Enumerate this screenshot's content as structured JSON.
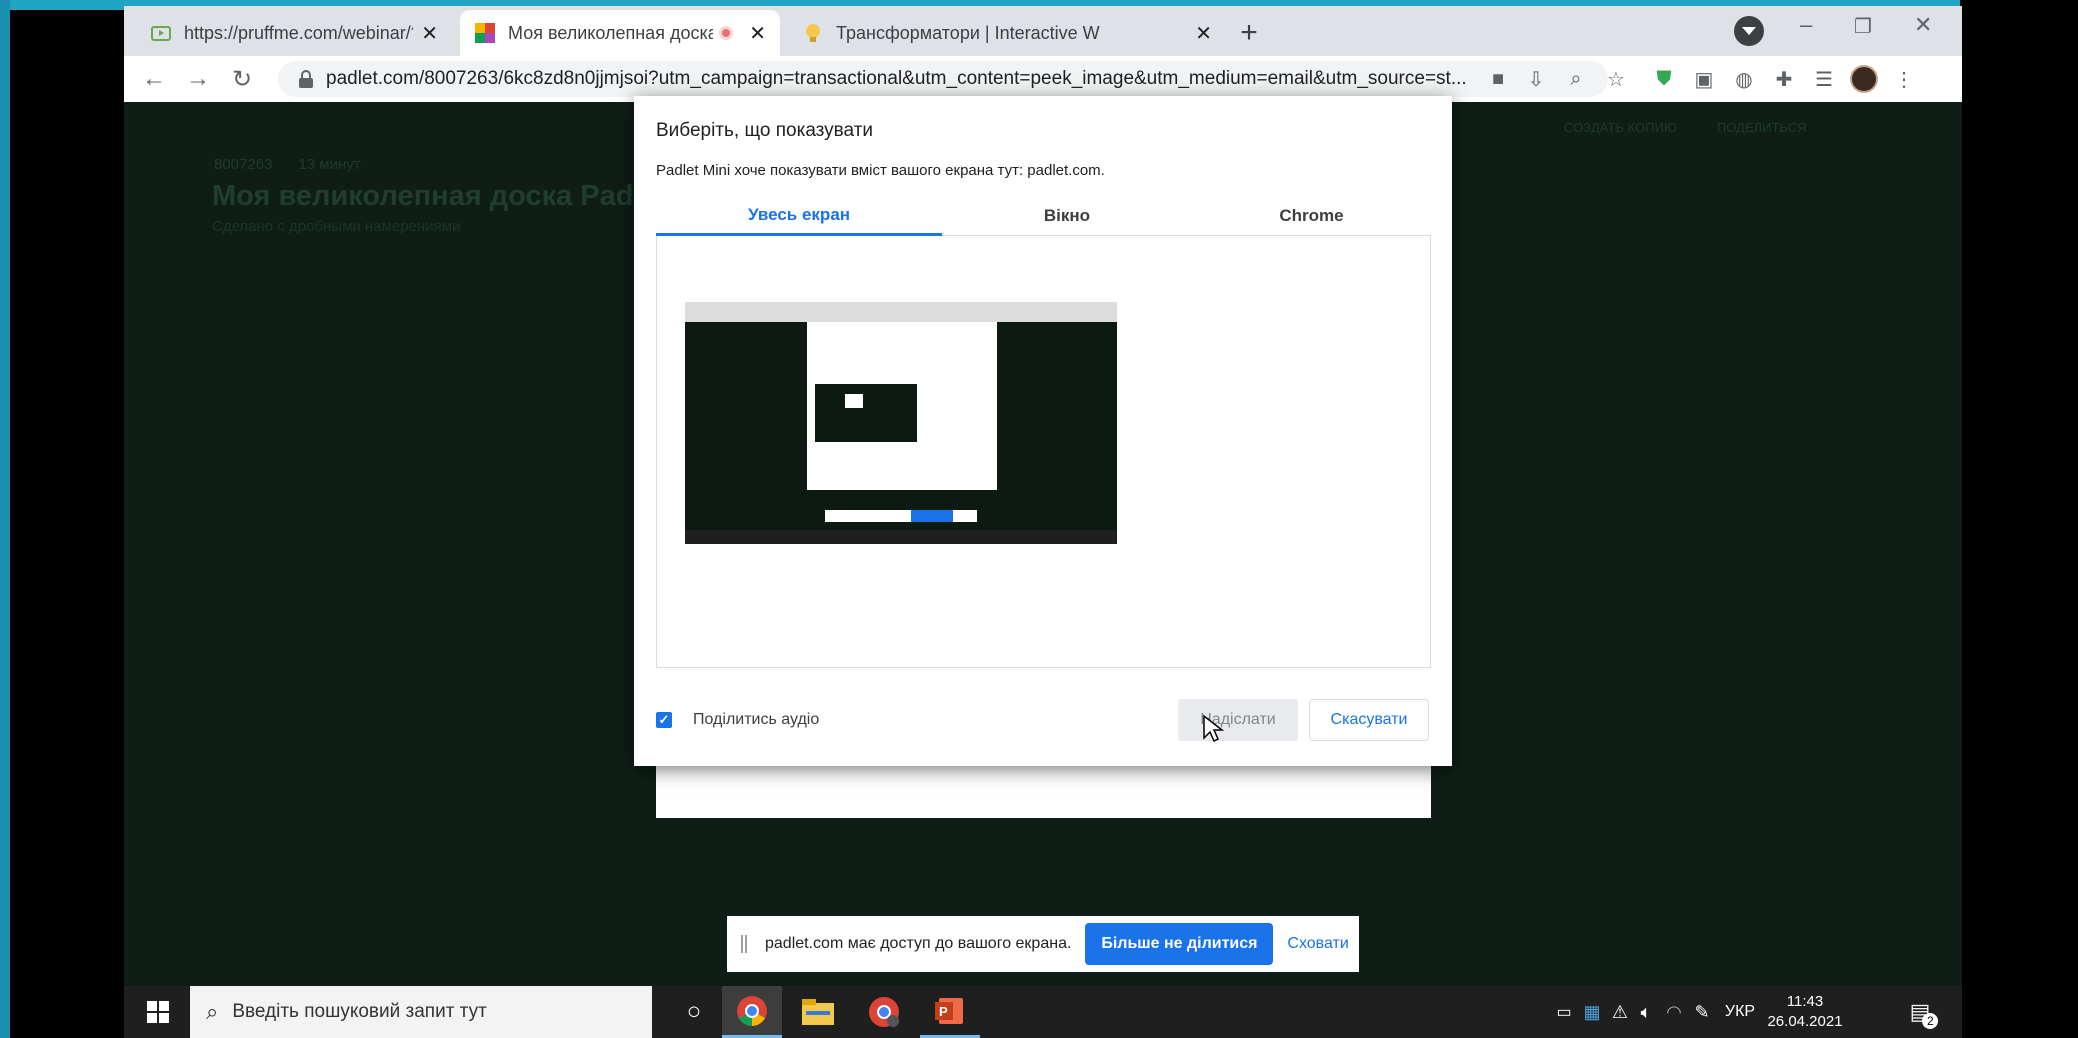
{
  "browser": {
    "tabs": [
      {
        "title": "https://pruffme.com/webinar/?id",
        "close": "✕"
      },
      {
        "title": "Моя великолепная доска Pa",
        "close": "✕"
      },
      {
        "title": "Трансформатори | Interactive W",
        "close": "✕"
      }
    ],
    "new_tab": "+",
    "url": "padlet.com/8007263/6kc8zd8n0jjmjsoi?utm_campaign=transactional&utm_content=peek_image&utm_medium=email&utm_source=st...",
    "window_controls": {
      "minimize": "–",
      "restore": "❐",
      "close": "✕"
    }
  },
  "page_bg": {
    "breadcrumb_user": "8007263",
    "breadcrumb_time": "13 минут",
    "title": "Моя великолепная доска Padlet",
    "subtitle": "Сделано с дробными намерениями",
    "header_action1": "СОЗДАТЬ КОПИЮ",
    "header_action2": "ПОДЕЛИТЬСЯ"
  },
  "dialog": {
    "title": "Виберіть, що показувати",
    "description": "Padlet Mini хоче показувати вміст вашого екрана тут: padlet.com.",
    "tabs": [
      "Увесь екран",
      "Вікно",
      "Chrome"
    ],
    "share_audio": "Поділитись аудіо",
    "share_audio_checked": true,
    "send_button": "Надіслати",
    "cancel_button": "Скасувати"
  },
  "share_bar": {
    "message": "padlet.com має доступ до вашого екрана.",
    "stop_button": "Більше не ділитися",
    "hide_button": "Сховати"
  },
  "taskbar": {
    "search_placeholder": "Введіть пошуковий запит тут",
    "language": "УКР",
    "time": "11:43",
    "date": "26.04.2021",
    "notifications": "2"
  },
  "colors": {
    "accent": "#1a73e8",
    "frame": "#1fa5c4",
    "page_dark": "#0e1e16"
  }
}
